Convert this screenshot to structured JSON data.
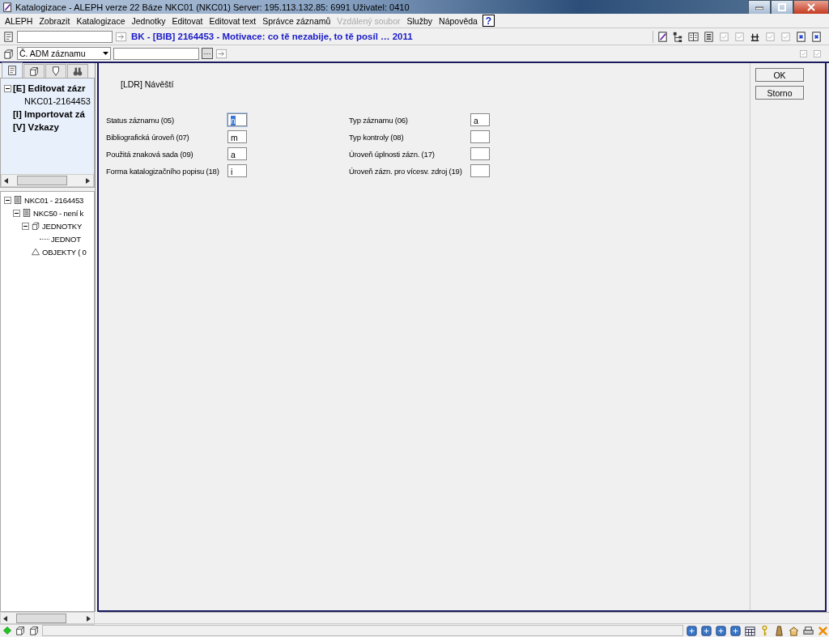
{
  "window": {
    "title": "Katalogizace - ALEPH verze 22  Báze NKC01 (NKC01)  Server: 195.113.132.85: 6991  Uživatel: 0410"
  },
  "menu": [
    {
      "label": "ALEPH",
      "disabled": false
    },
    {
      "label": "Zobrazit",
      "disabled": false
    },
    {
      "label": "Katalogizace",
      "disabled": false
    },
    {
      "label": "Jednotky",
      "disabled": false
    },
    {
      "label": "Editovat",
      "disabled": false
    },
    {
      "label": "Editovat text",
      "disabled": false
    },
    {
      "label": "Správce záznamů",
      "disabled": false
    },
    {
      "label": "Vzdálený soubor",
      "disabled": true
    },
    {
      "label": "Služby",
      "disabled": false
    },
    {
      "label": "Nápověda",
      "disabled": false
    }
  ],
  "help_button": "?",
  "record_heading": "BK - [BIB] 2164453 - Motivace: co tě nezabije, to tě posíl … 2011",
  "search_type": {
    "value": "Č. ADM záznamu"
  },
  "browse_button": "···",
  "left_tabs": [
    {
      "selected": true
    },
    {
      "selected": false
    },
    {
      "selected": false
    },
    {
      "selected": false
    }
  ],
  "task_tree": [
    {
      "label": "[E] Editovat zázr",
      "expanded": true,
      "children": [
        {
          "label": "NKC01-2164453"
        }
      ]
    },
    {
      "label": "[I] Importovat zá"
    },
    {
      "label": "[V] Vzkazy"
    }
  ],
  "record_tree": [
    {
      "kind": "record",
      "label": "NKC01 - 2164453",
      "expanded": true,
      "children": [
        {
          "kind": "record",
          "label": "NKC50 - není k",
          "expanded": true,
          "children": [
            {
              "kind": "units",
              "label": "JEDNOTKY",
              "expanded": true,
              "children": [
                {
                  "kind": "unit",
                  "label": "JEDNOT"
                }
              ]
            },
            {
              "kind": "objects",
              "label": "OBJEKTY ( 0"
            }
          ]
        }
      ]
    }
  ],
  "form": {
    "heading": "[LDR]  Návěští",
    "fields": [
      {
        "label": "Status záznamu (05)",
        "value": "n",
        "selected": true
      },
      {
        "label": "Typ záznamu (06)",
        "value": "a",
        "selected": false
      },
      {
        "label": "Bibliografická úroveň (07)",
        "value": "m",
        "selected": false
      },
      {
        "label": "Typ kontroly (08)",
        "selected": false
      },
      {
        "label": "Použitá znaková sada (09)",
        "value": "a",
        "selected": false
      },
      {
        "label": "Úroveň úplnosti zázn. (17)",
        "selected": false
      },
      {
        "label": "Forma katalogizačního popisu (18)",
        "value": "i",
        "selected": false
      },
      {
        "label": "Úroveň zázn. pro vícesv. zdroj (19)",
        "selected": false
      }
    ],
    "buttons": [
      "OK",
      "Storno"
    ]
  }
}
